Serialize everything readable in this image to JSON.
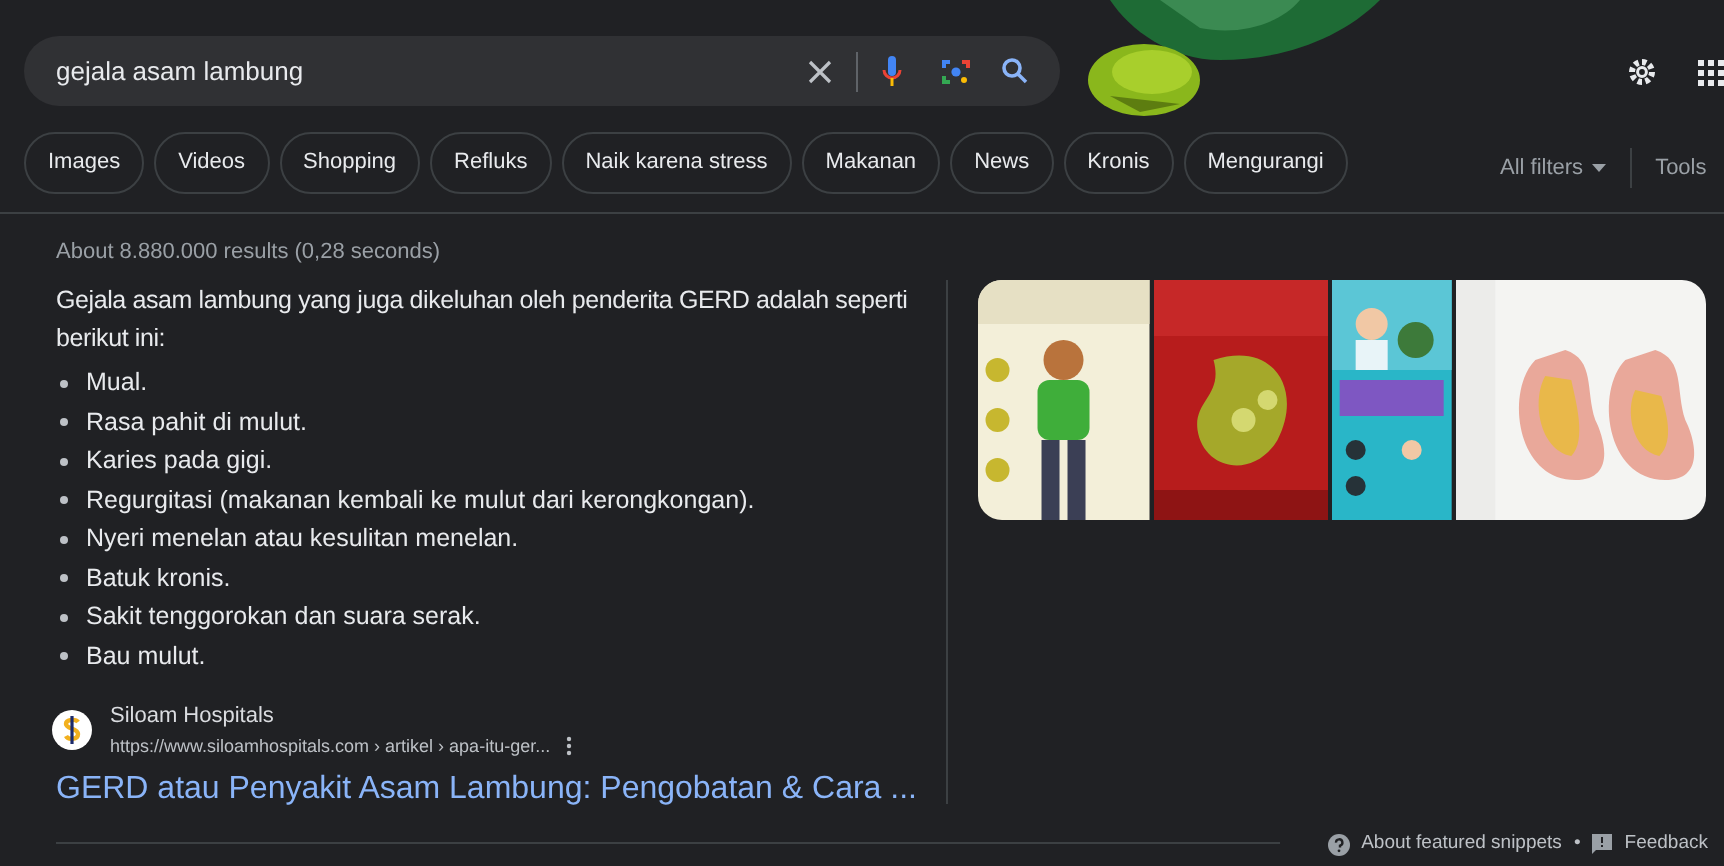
{
  "search": {
    "value": "gejala asam lambung"
  },
  "chips": [
    {
      "label": "Images"
    },
    {
      "label": "Videos"
    },
    {
      "label": "Shopping"
    },
    {
      "label": "Refluks"
    },
    {
      "label": "Naik karena stress"
    },
    {
      "label": "Makanan"
    },
    {
      "label": "News"
    },
    {
      "label": "Kronis"
    },
    {
      "label": "Mengurangi"
    }
  ],
  "tools": {
    "filters": "All filters",
    "tools": "Tools"
  },
  "result_stats": "About 8.880.000 results (0,28 seconds)",
  "snippet": {
    "intro": "Gejala asam lambung yang juga dikeluhan oleh penderita GERD adalah seperti berikut ini:",
    "bullets": [
      "Mual.",
      "Rasa pahit di mulut.",
      "Karies pada gigi.",
      "Regurgitasi (makanan kembali ke mulut dari kerongkongan).",
      "Nyeri menelan atau kesulitan menelan.",
      "Batuk kronis.",
      "Sakit tenggorokan dan suara serak.",
      "Bau mulut."
    ],
    "source": {
      "site": "Siloam Hospitals",
      "url": "https://www.siloamhospitals.com › artikel › apa-itu-ger...",
      "title": "GERD atau Penyakit Asam Lambung: Pengobatan & Cara ..."
    },
    "images": [
      {
        "kind": "picture"
      },
      {
        "kind": "picture"
      },
      {
        "kind": "picture"
      },
      {
        "kind": "picture"
      }
    ]
  },
  "footer": {
    "about": "About featured snippets",
    "separator": "•",
    "feedback": "Feedback"
  }
}
